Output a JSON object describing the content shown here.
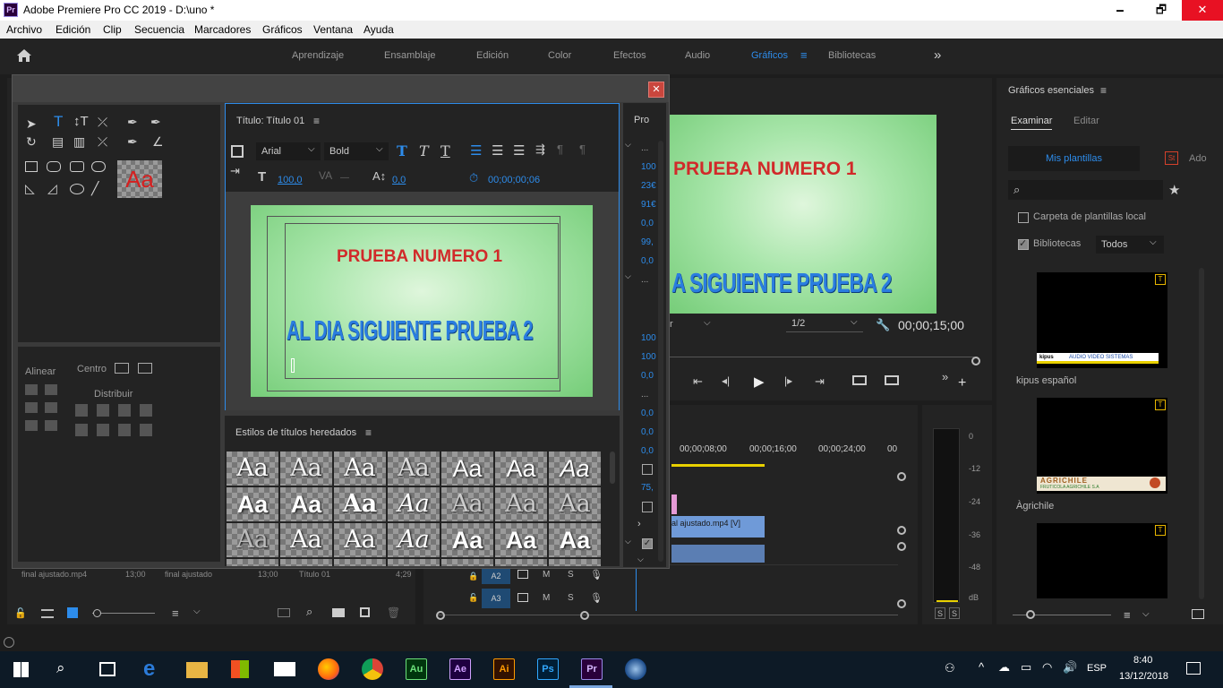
{
  "titlebar": {
    "logo": "Pr",
    "title": "Adobe Premiere Pro CC 2019 - D:\\uno *",
    "min": "🗕",
    "max": "🗗",
    "close": "✕"
  },
  "menu": [
    "Archivo",
    "Edición",
    "Clip",
    "Secuencia",
    "Marcadores",
    "Gráficos",
    "Ventana",
    "Ayuda"
  ],
  "workspaces": [
    "Aprendizaje",
    "Ensamblaje",
    "Edición",
    "Color",
    "Efectos",
    "Audio",
    "Gráficos",
    "Bibliotecas"
  ],
  "active_workspace": "Gráficos",
  "title_window": {
    "panel_title": "Título: Título 01",
    "properties_tab": "Pro",
    "font_family": "Arial",
    "font_style": "Bold",
    "font_size": "100,0",
    "kerning": "—",
    "leading": "0,0",
    "timecode": "00;00;00;06",
    "canvas_text_1": "PRUEBA NUMERO 1",
    "canvas_text_2": "AL DIA SIGUIENTE PRUEBA 2",
    "align_label": "Alinear",
    "center_label": "Centro",
    "distribute_label": "Distribuir",
    "styles_title": "Estilos de títulos heredados",
    "style_sample": "Aa",
    "prop_values": [
      "...",
      "100",
      "23€",
      "91€",
      "0,0",
      "99,",
      "0,0",
      "...",
      "100",
      "100",
      "0,0",
      "...",
      "0,0",
      "0,0",
      "0,0",
      "75,"
    ]
  },
  "program_monitor": {
    "text_1": "PRUEBA NUMERO 1",
    "text_2": "A SIGUIENTE PRUEBA 2",
    "resolution": "1/2",
    "fit_partial": "r",
    "timecode": "00;00;15;00"
  },
  "timeline": {
    "ticks": [
      "00;00;08;00",
      "00;00;16;00",
      "00;00;24;00",
      "00"
    ],
    "clip_label": "al ajustado.mp4 [V]",
    "tracks": [
      {
        "name": "A2",
        "m": "M",
        "s": "S"
      },
      {
        "name": "A3",
        "m": "M",
        "s": "S"
      }
    ]
  },
  "project_panel": {
    "row": [
      "final ajustado.mp4",
      "13;00",
      "final ajustado",
      "13;00",
      "Título 01",
      "4;29"
    ]
  },
  "audio_meter": {
    "labels": [
      "0",
      "-12",
      "-24",
      "-36",
      "-48",
      "dB"
    ],
    "solo": [
      "S",
      "S"
    ]
  },
  "essential_graphics": {
    "title": "Gráficos esenciales",
    "tabs": [
      "Examinar",
      "Editar"
    ],
    "active_tab": "Examinar",
    "my_templates": "Mis plantillas",
    "stock_label": "Ado",
    "stock_badge": "St",
    "local_templates": "Carpeta de plantillas local",
    "libraries": "Bibliotecas",
    "libraries_filter": "Todos",
    "templates": [
      {
        "name": "kipus español",
        "thumb_text": "AUDIO VIDEO SISTEMAS",
        "thumb_logo": "kipus"
      },
      {
        "name": "Àgrichile",
        "thumb_text": "AGRICHILE",
        "thumb_sub": "FRUTICOLA AGRICHILE S.A"
      },
      {
        "name": "",
        "thumb_text": ""
      }
    ]
  },
  "taskbar": {
    "apps": [
      "Au",
      "Ae",
      "Ai",
      "Ps",
      "Pr"
    ],
    "lang": "ESP",
    "time": "8:40",
    "date": "13/12/2018"
  },
  "colors": {
    "accent": "#2d8ceb",
    "close_red": "#e81123",
    "title_red": "#d12a2a",
    "title_blue": "#2a7de0",
    "timeline_yellow": "#e8d000",
    "clip_blue": "#6f9ad8"
  }
}
